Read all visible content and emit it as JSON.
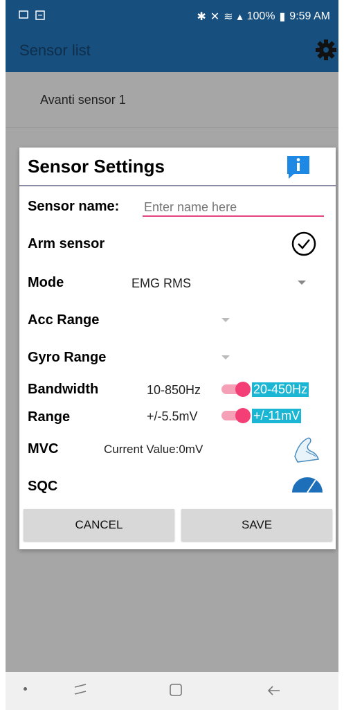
{
  "status": {
    "battery": "100%",
    "time": "9:59 AM"
  },
  "app": {
    "title": "Sensor list"
  },
  "list": {
    "items": [
      "Avanti sensor 1"
    ]
  },
  "dialog": {
    "title": "Sensor Settings",
    "sensor_name_label": "Sensor name:",
    "sensor_name_placeholder": "Enter name here",
    "arm_label": "Arm sensor",
    "mode_label": "Mode",
    "mode_value": "EMG RMS",
    "acc_label": "Acc Range",
    "gyro_label": "Gyro Range",
    "bandwidth_label": "Bandwidth",
    "bandwidth_off": "10-850Hz",
    "bandwidth_on": "20-450Hz",
    "range_label": "Range",
    "range_off": "+/-5.5mV",
    "range_on": "+/-11mV",
    "mvc_label": "MVC",
    "mvc_value": "Current Value:0mV",
    "sqc_label": "SQC",
    "cancel": "CANCEL",
    "save": "SAVE"
  },
  "colors": {
    "appbar": "#174f7e",
    "accent": "#f43e76",
    "highlight": "#1ab6d3",
    "info": "#1e88e5"
  }
}
